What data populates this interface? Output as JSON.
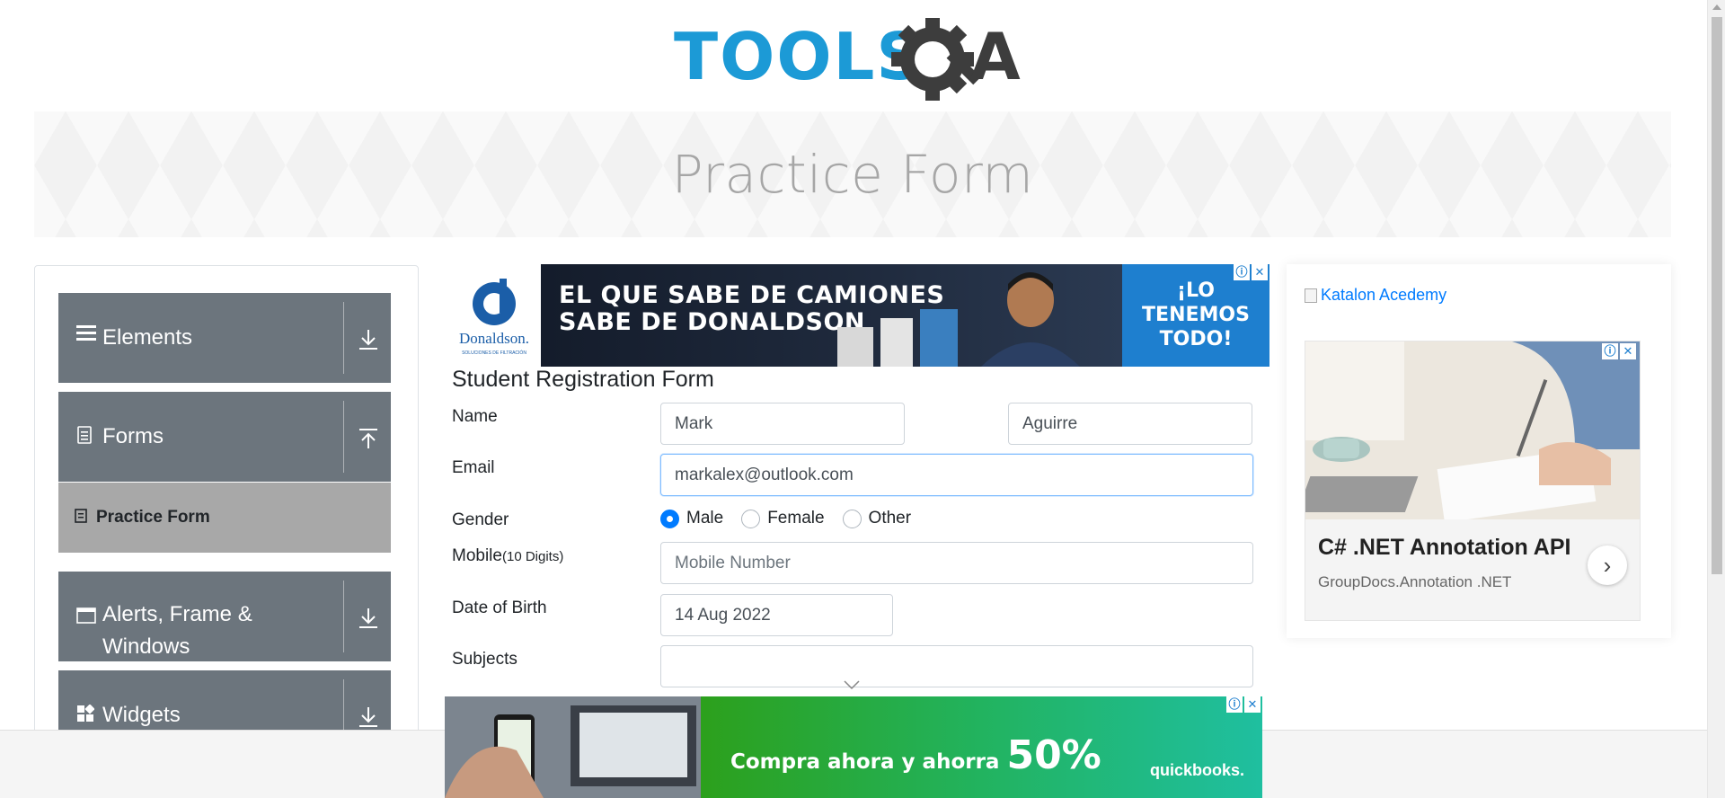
{
  "brand": {
    "logo_text_left": "TOOLS",
    "logo_text_right": "A"
  },
  "banner": {
    "title": "Practice Form"
  },
  "sidebar": {
    "groups": [
      {
        "label": "Elements",
        "icon": "hamburger-icon"
      },
      {
        "label": "Forms",
        "icon": "document-icon",
        "active_item": "Practice Form"
      },
      {
        "label_line1": "Alerts, Frame &",
        "label_line2": "Windows",
        "icon": "window-icon"
      },
      {
        "label": "Widgets",
        "icon": "widgets-icon"
      }
    ]
  },
  "ad_top": {
    "brand": "Donaldson.",
    "brand_sub": "SOLUCIONES DE FILTRACIÓN",
    "headline_line1": "EL QUE SABE DE CAMIONES",
    "headline_line2": "SABE DE DONALDSON",
    "cta_line1": "¡LO",
    "cta_line2": "TENEMOS",
    "cta_line3": "TODO!"
  },
  "form": {
    "title": "Student Registration Form",
    "name_label": "Name",
    "first_name": "Mark",
    "last_name": "Aguirre",
    "email_label": "Email",
    "email": "markalex@outlook.com",
    "gender_label": "Gender",
    "gender_options": [
      "Male",
      "Female",
      "Other"
    ],
    "gender_selected": "Male",
    "mobile_label": "Mobile",
    "mobile_hint": "(10 Digits)",
    "mobile_placeholder": "Mobile Number",
    "dob_label": "Date of Birth",
    "dob": "14 Aug 2022",
    "subjects_label": "Subjects"
  },
  "ad_right": {
    "katalon_alt": "Katalon Acedemy",
    "title": "C# .NET Annotation API",
    "subtitle": "GroupDocs.Annotation .NET"
  },
  "ad_bottom": {
    "text": "Compra ahora y ahorra",
    "percent": "50%",
    "brand": "quickbooks."
  },
  "colors": {
    "sidebar_bg": "#6c757d",
    "active_item_bg": "#a8a8a8",
    "accent": "#007bff",
    "logo_blue": "#1c9ad6",
    "logo_dark": "#3d3d3d"
  }
}
